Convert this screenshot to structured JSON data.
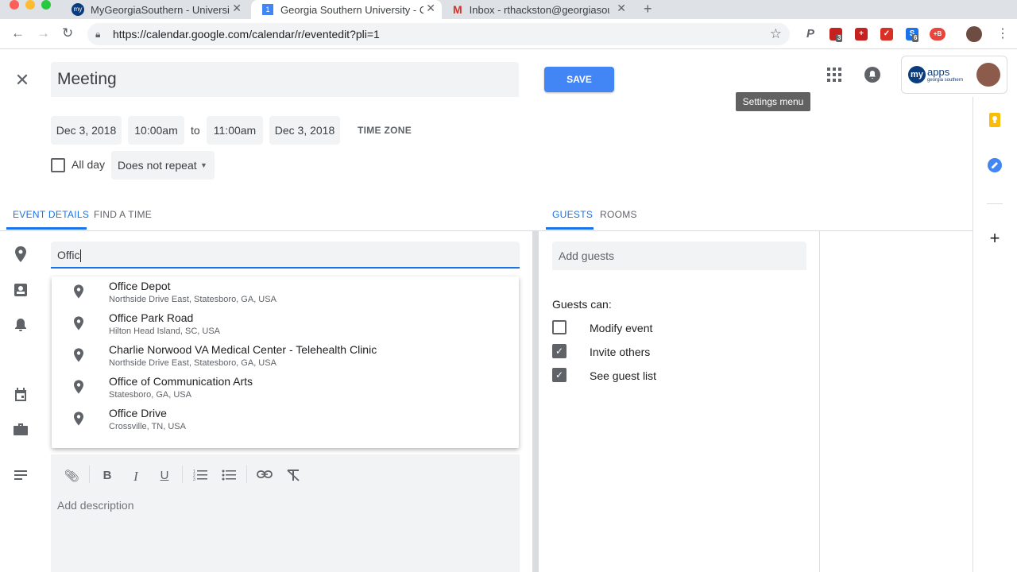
{
  "browser": {
    "tabs": [
      {
        "label": "MyGeorgiaSouthern - Universit",
        "favicon": "my"
      },
      {
        "label": "Georgia Southern University - C",
        "favicon": "1"
      },
      {
        "label": "Inbox - rthackston@georgiasou",
        "favicon": "M"
      }
    ],
    "url": "https://calendar.google.com/calendar/r/eventedit?pli=1",
    "extension_badges": {
      "ext1": "3",
      "ext2": "6"
    }
  },
  "event": {
    "title": "Meeting",
    "start_date": "Dec 3, 2018",
    "start_time": "10:00am",
    "to_label": "to",
    "end_time": "11:00am",
    "end_date": "Dec 3, 2018",
    "time_zone_label": "TIME ZONE",
    "all_day_label": "All day",
    "repeat_value": "Does not repeat",
    "save_label": "SAVE"
  },
  "header": {
    "tooltip": "Settings menu",
    "myapps_brand": "my",
    "myapps_word": "apps",
    "myapps_sub": "georgia southern"
  },
  "details_tabs": [
    "EVENT DETAILS",
    "FIND A TIME"
  ],
  "location": {
    "value": "Offic",
    "suggestions": [
      {
        "main": "Office Depot",
        "sub": "Northside Drive East, Statesboro, GA, USA"
      },
      {
        "main": "Office Park Road",
        "sub": "Hilton Head Island, SC, USA"
      },
      {
        "main": "Charlie Norwood VA Medical Center - Telehealth Clinic",
        "sub": "Northside Drive East, Statesboro, GA, USA"
      },
      {
        "main": "Office of Communication Arts",
        "sub": "Statesboro, GA, USA"
      },
      {
        "main": "Office Drive",
        "sub": "Crossville, TN, USA"
      }
    ]
  },
  "description": {
    "placeholder": "Add description"
  },
  "guests_tabs": [
    "GUESTS",
    "ROOMS"
  ],
  "guests": {
    "placeholder": "Add guests",
    "can_label": "Guests can:",
    "permissions": [
      {
        "label": "Modify event",
        "checked": false
      },
      {
        "label": "Invite others",
        "checked": true
      },
      {
        "label": "See guest list",
        "checked": true
      }
    ]
  },
  "colors": {
    "accent": "#1a73e8",
    "save": "#4285f4"
  }
}
